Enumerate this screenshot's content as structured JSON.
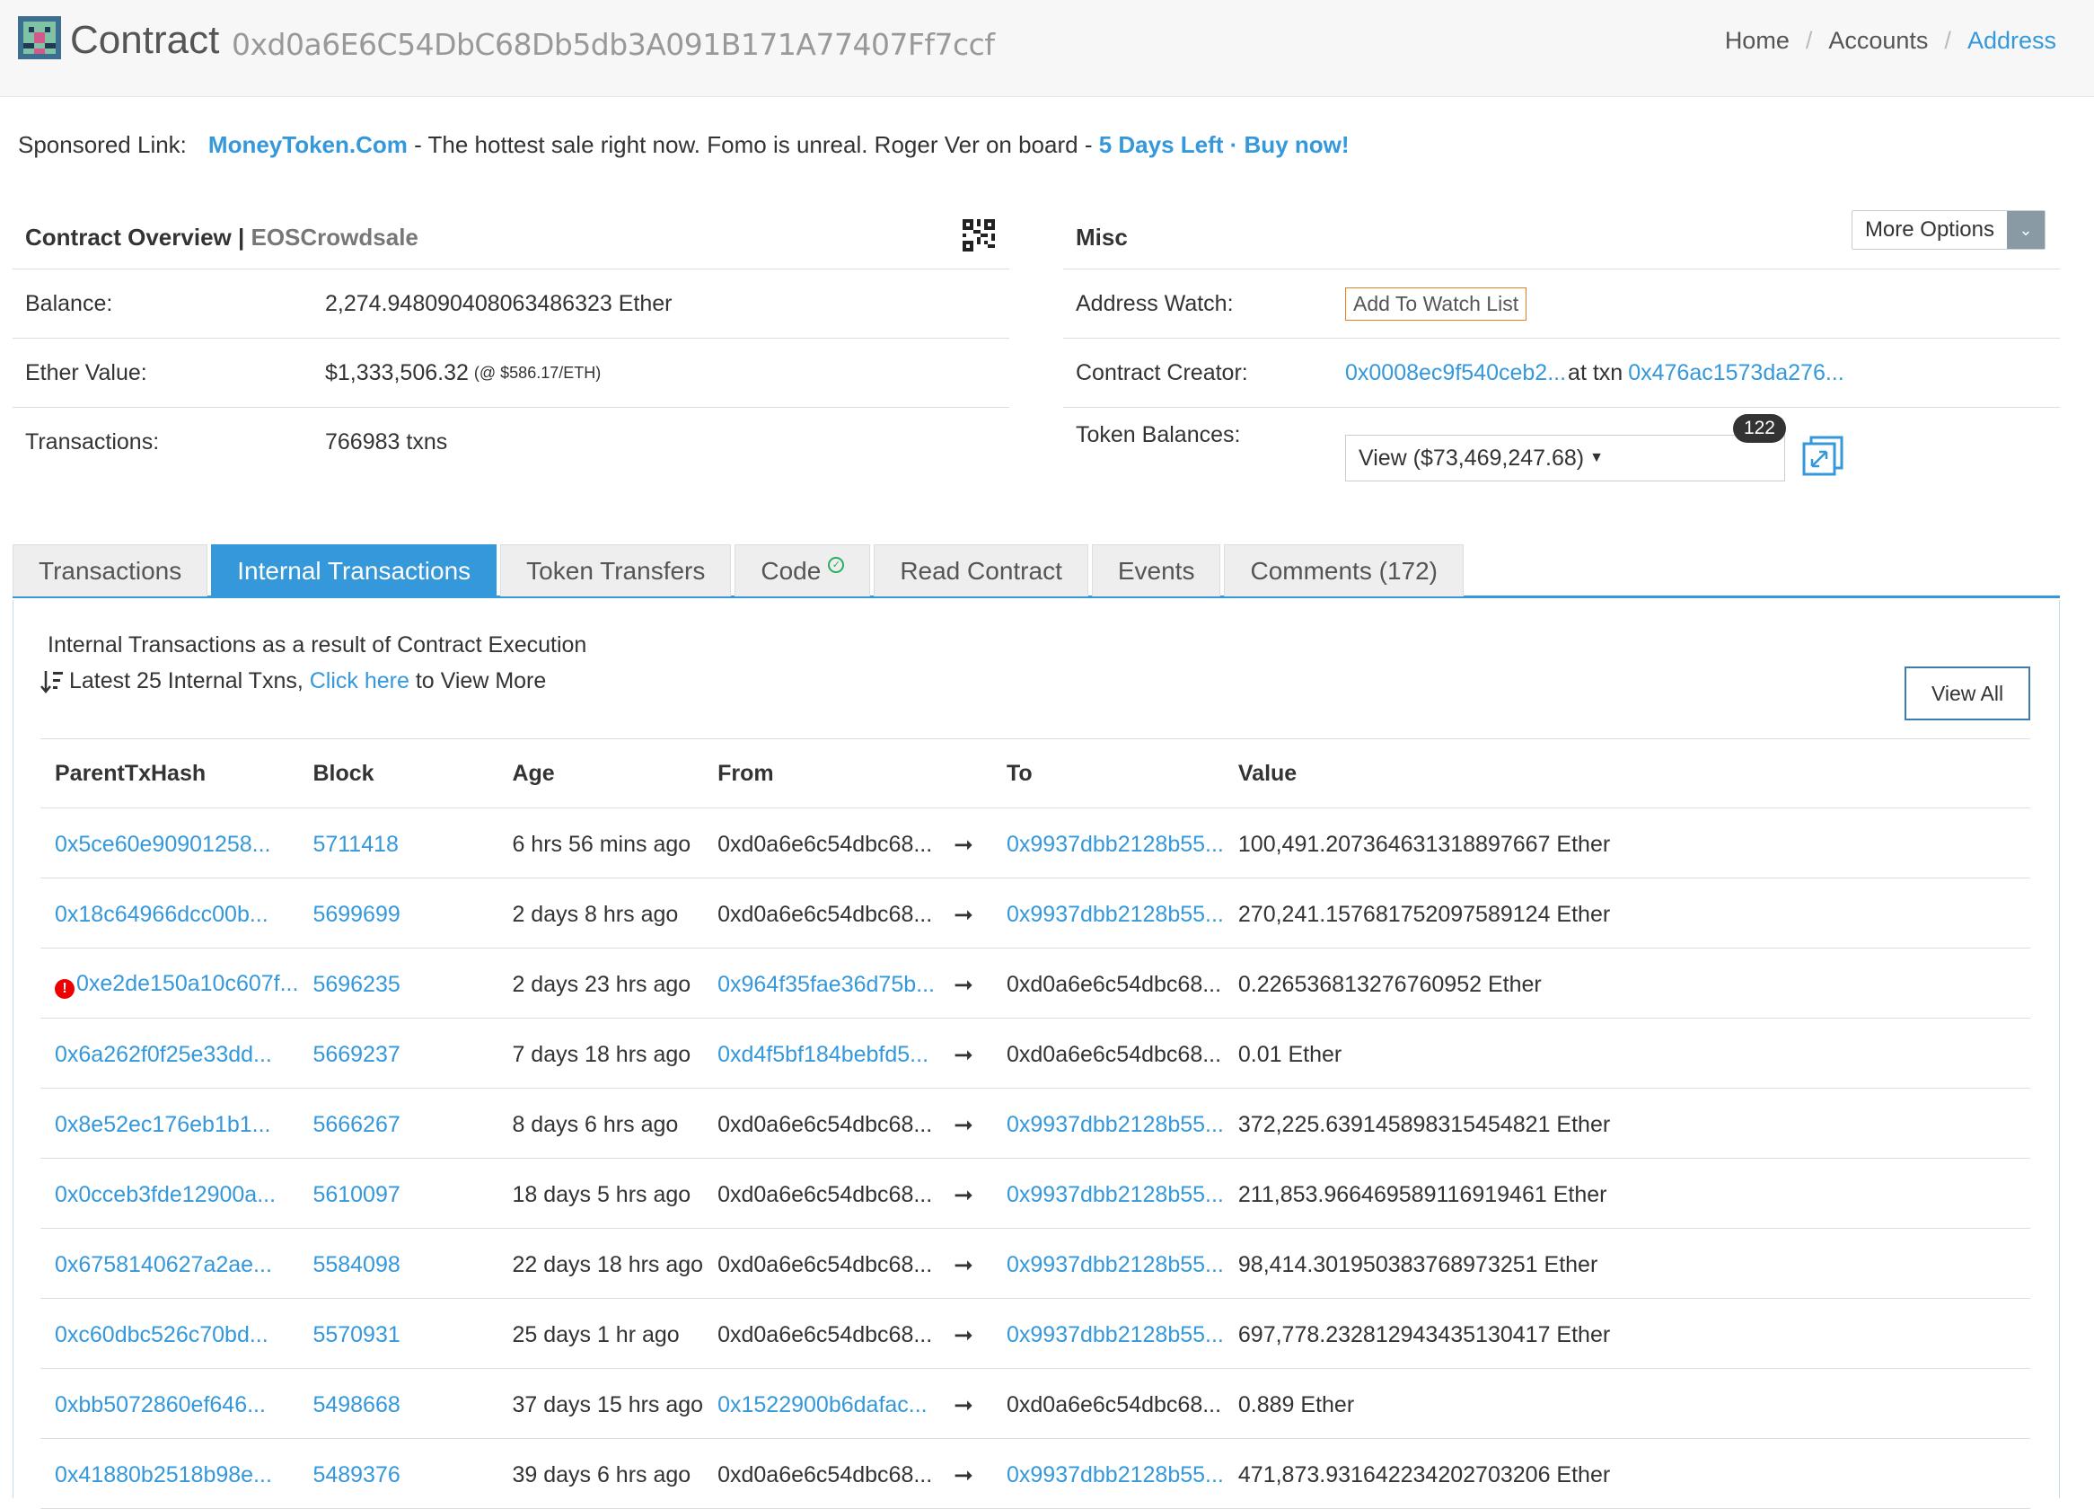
{
  "header": {
    "title": "Contract",
    "address": "0xd0a6E6C54DbC68Db5db3A091B171A77407Ff7ccf",
    "breadcrumb": [
      "Home",
      "Accounts",
      "Address"
    ]
  },
  "sponsor": {
    "label": "Sponsored Link:",
    "brand": "MoneyToken.Com",
    "text": " - The hottest sale right now. Fomo is unreal. Roger Ver on board - ",
    "cta": "5 Days Left · Buy now!"
  },
  "overview": {
    "title": "Contract Overview",
    "separator": " | ",
    "subtitle": "EOSCrowdsale",
    "balance_label": "Balance:",
    "balance_value": "2,274.948090408063486323 Ether",
    "ether_value_label": "Ether Value:",
    "ether_value": "$1,333,506.32",
    "ether_rate": "(@ $586.17/ETH)",
    "transactions_label": "Transactions:",
    "transactions_value": "766983 txns"
  },
  "misc": {
    "title": "Misc",
    "more_options": "More Options",
    "watch_label": "Address Watch:",
    "watch_button": "Add To Watch List",
    "creator_label": "Contract Creator:",
    "creator_address": "0x0008ec9f540ceb2...",
    "creator_at": "at txn",
    "creator_txn": "0x476ac1573da276...",
    "token_label": "Token Balances:",
    "token_view": "View ($73,469,247.68)",
    "token_count": "122"
  },
  "tabs": [
    {
      "label": "Transactions",
      "active": false
    },
    {
      "label": "Internal Transactions",
      "active": true
    },
    {
      "label": "Token Transfers",
      "active": false
    },
    {
      "label": "Code",
      "active": false
    },
    {
      "label": "Read Contract",
      "active": false
    },
    {
      "label": "Events",
      "active": false
    },
    {
      "label": "Comments (172)",
      "active": false
    }
  ],
  "internal": {
    "description": "Internal Transactions as a result of Contract Execution",
    "latest_prefix": "Latest 25 Internal Txns, ",
    "click_here": "Click here",
    "latest_suffix": " to View More",
    "view_all": "View All",
    "columns": [
      "ParentTxHash",
      "Block",
      "Age",
      "From",
      "",
      "To",
      "Value"
    ],
    "rows": [
      {
        "hash": "0x5ce60e90901258...",
        "error": false,
        "block": "5711418",
        "age": "6 hrs 56 mins ago",
        "from": "0xd0a6e6c54dbc68...",
        "from_link": false,
        "arrow": "➞",
        "to": "0x9937dbb2128b55...",
        "to_link": true,
        "value": "100,491.207364631318897667 Ether"
      },
      {
        "hash": "0x18c64966dcc00b...",
        "error": false,
        "block": "5699699",
        "age": "2 days 8 hrs ago",
        "from": "0xd0a6e6c54dbc68...",
        "from_link": false,
        "arrow": "➞",
        "to": "0x9937dbb2128b55...",
        "to_link": true,
        "value": "270,241.157681752097589124 Ether"
      },
      {
        "hash": "0xe2de150a10c607f...",
        "error": true,
        "block": "5696235",
        "age": "2 days 23 hrs ago",
        "from": "0x964f35fae36d75b...",
        "from_link": true,
        "arrow": "➞",
        "to": "0xd0a6e6c54dbc68...",
        "to_link": false,
        "value": "0.226536813276760952 Ether"
      },
      {
        "hash": "0x6a262f0f25e33dd...",
        "error": false,
        "block": "5669237",
        "age": "7 days 18 hrs ago",
        "from": "0xd4f5bf184bebfd5...",
        "from_link": true,
        "arrow": "➞",
        "to": "0xd0a6e6c54dbc68...",
        "to_link": false,
        "value": "0.01 Ether"
      },
      {
        "hash": "0x8e52ec176eb1b1...",
        "error": false,
        "block": "5666267",
        "age": "8 days 6 hrs ago",
        "from": "0xd0a6e6c54dbc68...",
        "from_link": false,
        "arrow": "➞",
        "to": "0x9937dbb2128b55...",
        "to_link": true,
        "value": "372,225.639145898315454821 Ether"
      },
      {
        "hash": "0x0cceb3fde12900a...",
        "error": false,
        "block": "5610097",
        "age": "18 days 5 hrs ago",
        "from": "0xd0a6e6c54dbc68...",
        "from_link": false,
        "arrow": "➞",
        "to": "0x9937dbb2128b55...",
        "to_link": true,
        "value": "211,853.966469589116919461 Ether"
      },
      {
        "hash": "0x6758140627a2ae...",
        "error": false,
        "block": "5584098",
        "age": "22 days 18 hrs ago",
        "from": "0xd0a6e6c54dbc68...",
        "from_link": false,
        "arrow": "➞",
        "to": "0x9937dbb2128b55...",
        "to_link": true,
        "value": "98,414.301950383768973251 Ether"
      },
      {
        "hash": "0xc60dbc526c70bd...",
        "error": false,
        "block": "5570931",
        "age": "25 days 1 hr ago",
        "from": "0xd0a6e6c54dbc68...",
        "from_link": false,
        "arrow": "➞",
        "to": "0x9937dbb2128b55...",
        "to_link": true,
        "value": "697,778.232812943435130417 Ether"
      },
      {
        "hash": "0xbb5072860ef646...",
        "error": false,
        "block": "5498668",
        "age": "37 days 15 hrs ago",
        "from": "0x1522900b6dafac...",
        "from_link": true,
        "arrow": "➞",
        "to": "0xd0a6e6c54dbc68...",
        "to_link": false,
        "value": "0.889 Ether"
      },
      {
        "hash": "0x41880b2518b98e...",
        "error": false,
        "block": "5489376",
        "age": "39 days 6 hrs ago",
        "from": "0xd0a6e6c54dbc68...",
        "from_link": false,
        "arrow": "➞",
        "to": "0x9937dbb2128b55...",
        "to_link": true,
        "value": "471,873.931642234202703206 Ether"
      }
    ]
  }
}
